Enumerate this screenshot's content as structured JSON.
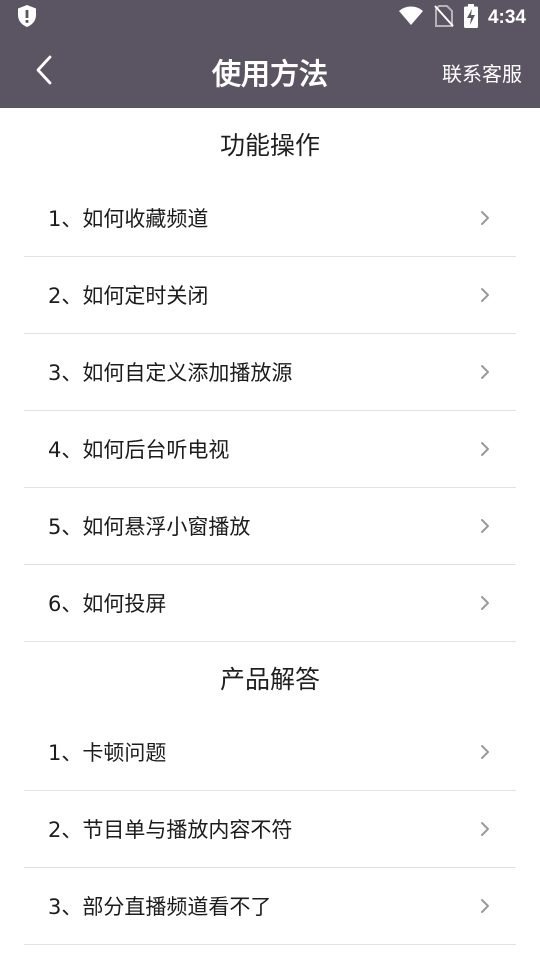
{
  "status_bar": {
    "time": "4:34",
    "icons": [
      "shield-alert-icon",
      "wifi-icon",
      "no-sim-icon",
      "battery-charging-icon"
    ]
  },
  "header": {
    "title": "使用方法",
    "contact_label": "联系客服",
    "back_icon": "chevron-left-icon"
  },
  "sections": [
    {
      "title": "功能操作",
      "items": [
        {
          "label": "1、如何收藏频道"
        },
        {
          "label": "2、如何定时关闭"
        },
        {
          "label": "3、如何自定义添加播放源"
        },
        {
          "label": "4、如何后台听电视"
        },
        {
          "label": "5、如何悬浮小窗播放"
        },
        {
          "label": "6、如何投屏"
        }
      ]
    },
    {
      "title": "产品解答",
      "items": [
        {
          "label": "1、卡顿问题"
        },
        {
          "label": "2、节目单与播放内容不符"
        },
        {
          "label": "3、部分直播频道看不了"
        }
      ]
    }
  ],
  "colors": {
    "header_bg": "#5b5462",
    "divider": "#e2e2e2",
    "chevron": "#9a9a9a"
  }
}
